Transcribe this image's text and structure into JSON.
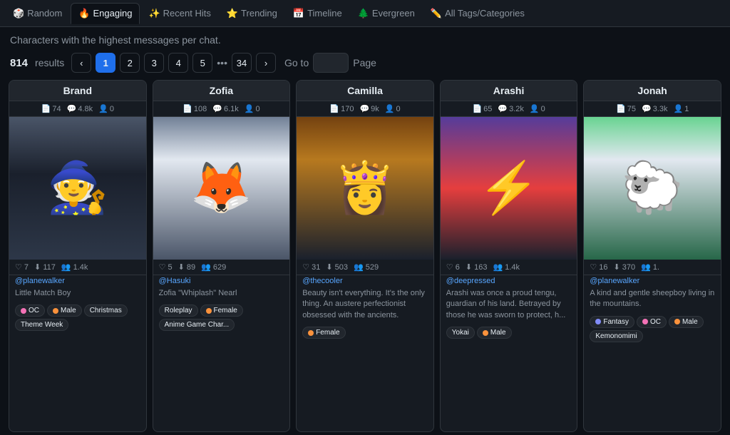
{
  "nav": {
    "items": [
      {
        "id": "random",
        "label": "Random",
        "icon": "🎲",
        "active": false
      },
      {
        "id": "engaging",
        "label": "Engaging",
        "icon": "🔥",
        "active": true
      },
      {
        "id": "recent-hits",
        "label": "Recent Hits",
        "icon": "✨",
        "active": false
      },
      {
        "id": "trending",
        "label": "Trending",
        "icon": "⭐",
        "active": false
      },
      {
        "id": "timeline",
        "label": "Timeline",
        "icon": "📅",
        "active": false
      },
      {
        "id": "evergreen",
        "label": "Evergreen",
        "icon": "🌲",
        "active": false
      },
      {
        "id": "all-tags",
        "label": "All Tags/Categories",
        "icon": "✏️",
        "active": false
      }
    ]
  },
  "subtitle": "Characters with the highest messages per chat.",
  "pagination": {
    "results": "814",
    "results_label": "results",
    "pages": [
      "1",
      "2",
      "3",
      "4",
      "5"
    ],
    "dots": "•••",
    "last_page": "34",
    "goto_label": "Go to",
    "page_label": "Page"
  },
  "cards": [
    {
      "name": "Brand",
      "stats": {
        "pages": "74",
        "messages": "4.8k",
        "users": "0"
      },
      "actions": {
        "likes": "7",
        "downloads": "117",
        "shares": "1.4k"
      },
      "author": "@planewalker",
      "description": "Little Match Boy",
      "tags": [
        {
          "label": "OC",
          "color": "#f472b6"
        },
        {
          "label": "Male",
          "color": "#fb923c"
        },
        {
          "label": "Christmas",
          "color": null
        },
        {
          "label": "Theme Week",
          "color": null
        }
      ],
      "img_class": "img-brand",
      "img_char": "🧙"
    },
    {
      "name": "Zofia",
      "stats": {
        "pages": "108",
        "messages": "6.1k",
        "users": "0"
      },
      "actions": {
        "likes": "5",
        "downloads": "89",
        "shares": "629"
      },
      "author": "@Hasuki",
      "description": "Zofia \"Whiplash\" Nearl",
      "tags": [
        {
          "label": "Roleplay",
          "color": null
        },
        {
          "label": "Female",
          "color": "#fb923c"
        },
        {
          "label": "Anime Game Char...",
          "color": null
        }
      ],
      "img_class": "img-zofia",
      "img_char": "🦊"
    },
    {
      "name": "Camilla",
      "stats": {
        "pages": "170",
        "messages": "9k",
        "users": "0"
      },
      "actions": {
        "likes": "31",
        "downloads": "503",
        "shares": "529"
      },
      "author": "@thecooler",
      "description": "Beauty isn't everything. It's the only thing. An austere perfectionist obsessed with the ancients.",
      "tags": [
        {
          "label": "Female",
          "color": "#fb923c"
        }
      ],
      "img_class": "img-camilla",
      "img_char": "👸"
    },
    {
      "name": "Arashi",
      "stats": {
        "pages": "65",
        "messages": "3.2k",
        "users": "0"
      },
      "actions": {
        "likes": "6",
        "downloads": "163",
        "shares": "1.4k"
      },
      "author": "@deepressed",
      "description": "Arashi was once a proud tengu, guardian of his land. Betrayed by those he was sworn to protect, h...",
      "tags": [
        {
          "label": "Yokai",
          "color": null
        },
        {
          "label": "Male",
          "color": "#fb923c"
        }
      ],
      "img_class": "img-arashi",
      "img_char": "⚡"
    },
    {
      "name": "Jonah",
      "stats": {
        "pages": "75",
        "messages": "3.3k",
        "users": "1"
      },
      "actions": {
        "likes": "16",
        "downloads": "370",
        "shares": "1."
      },
      "author": "@planewalker",
      "description": "A kind and gentle sheepboy living in the mountains.",
      "tags": [
        {
          "label": "Fantasy",
          "color": "#818cf8"
        },
        {
          "label": "OC",
          "color": "#f472b6"
        },
        {
          "label": "Male",
          "color": "#fb923c"
        },
        {
          "label": "Kemonomimi",
          "color": null
        }
      ],
      "img_class": "img-jonah",
      "img_char": "🐑"
    }
  ]
}
